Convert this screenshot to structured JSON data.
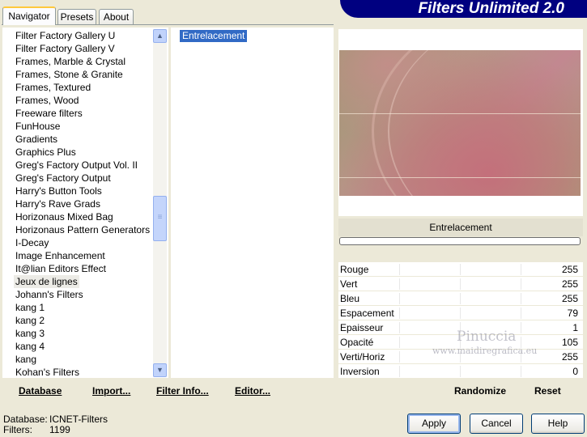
{
  "tabs": [
    {
      "label": "Navigator"
    },
    {
      "label": "Presets"
    },
    {
      "label": "About"
    }
  ],
  "app_title": "Filters Unlimited 2.0",
  "categories": [
    "Filter Factory Gallery U",
    "Filter Factory Gallery V",
    "Frames, Marble & Crystal",
    "Frames, Stone & Granite",
    "Frames, Textured",
    "Frames, Wood",
    "Freeware filters",
    "FunHouse",
    "Gradients",
    "Graphics Plus",
    "Greg's Factory Output Vol. II",
    "Greg's Factory Output",
    "Harry's Button Tools",
    "Harry's Rave Grads",
    "Horizonaus Mixed Bag",
    "Horizonaus Pattern Generators",
    "I-Decay",
    "Image Enhancement",
    "It@lian Editors Effect",
    "Jeux de lignes",
    "Johann's Filters",
    "kang 1",
    "kang 2",
    "kang 3",
    "kang 4",
    "kang",
    "Kohan's Filters"
  ],
  "selected_category_index": 19,
  "filters": [
    "Entrelacement"
  ],
  "selected_filter_name": "Entrelacement",
  "parameters": [
    {
      "name": "Rouge",
      "value": "255"
    },
    {
      "name": "Vert",
      "value": "255"
    },
    {
      "name": "Bleu",
      "value": "255"
    },
    {
      "name": "Espacement",
      "value": "79"
    },
    {
      "name": "Epaisseur",
      "value": "1"
    },
    {
      "name": "Opacité",
      "value": "105"
    },
    {
      "name": "Verti/Horiz",
      "value": "255"
    },
    {
      "name": "Inversion",
      "value": "0"
    }
  ],
  "watermark": {
    "line1": "Pinuccia",
    "line2": "www.maidiregrafica.eu"
  },
  "toolbar": {
    "database": "Database",
    "import": "Import...",
    "filter_info": "Filter Info...",
    "editor": "Editor...",
    "randomize": "Randomize",
    "reset": "Reset"
  },
  "status": {
    "database_label": "Database:",
    "database_value": "ICNET-Filters",
    "filters_label": "Filters:",
    "filters_value": "1199"
  },
  "buttons": {
    "apply": "Apply",
    "cancel": "Cancel",
    "help": "Help"
  },
  "colors": {
    "banner": "#000080",
    "selection": "#316ac5",
    "dialog_bg": "#ece9d8"
  }
}
